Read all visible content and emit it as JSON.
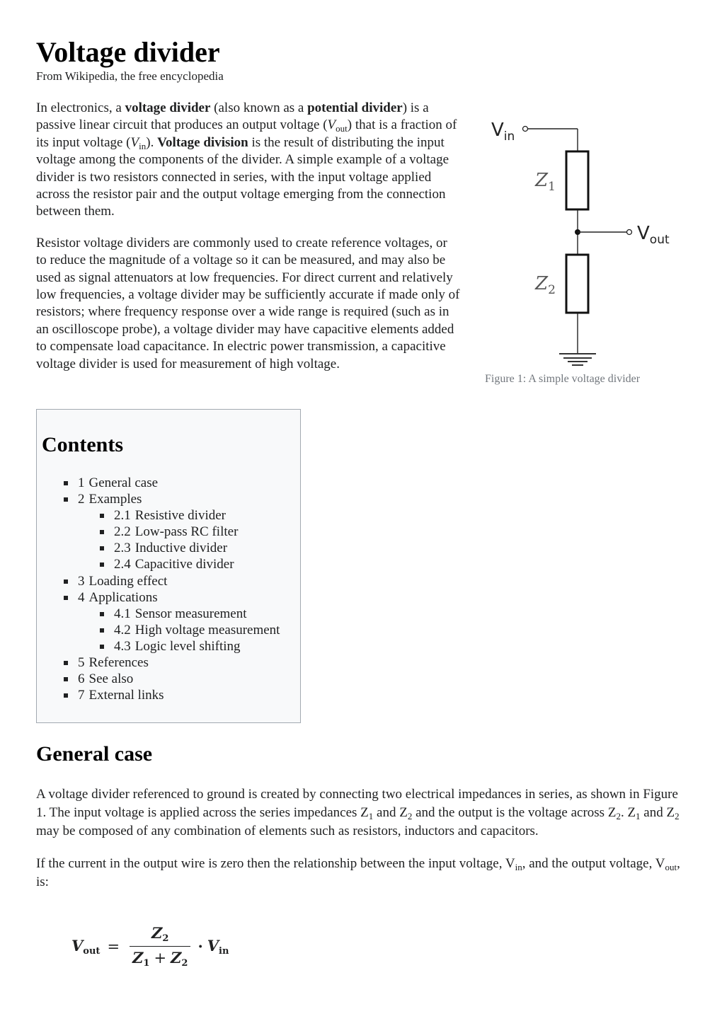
{
  "article": {
    "title": "Voltage divider",
    "subtitle": "From Wikipedia, the free encyclopedia"
  },
  "lead": {
    "p1": {
      "t1": "In electronics, a ",
      "b1": "voltage divider",
      "t2": " (also known as a ",
      "b2": "potential divider",
      "t3": ") is a passive linear circuit that produces an output voltage (",
      "v_out_sym": "V",
      "v_out_sub": "out",
      "t4": ") that is a fraction of its input voltage (",
      "v_in_sym": "V",
      "v_in_sub": "in",
      "t5": "). ",
      "b3": "Voltage division",
      "t6": " is the result of distributing the input voltage among the components of the divider. A simple example of a voltage divider is two resistors connected in series, with the input voltage applied across the resistor pair and the output voltage emerging from the connection between them."
    },
    "p2": "Resistor voltage dividers are commonly used to create reference voltages, or to reduce the magnitude of a voltage so it can be measured, and may also be used as signal attenuators at low frequencies. For direct current and relatively low frequencies, a voltage divider may be sufficiently accurate if made only of resistors; where frequency response over a wide range is required (such as in an oscilloscope probe), a voltage divider may have capacitive elements added to compensate load capacitance. In electric power transmission, a capacitive voltage divider is used for measurement of high voltage."
  },
  "figure": {
    "caption": "Figure 1: A simple voltage divider",
    "labels": {
      "vin": "V",
      "vin_sub": "in",
      "vout": "V",
      "vout_sub": "out",
      "z1": "Z",
      "z1_sub": "1",
      "z2": "Z",
      "z2_sub": "2"
    }
  },
  "toc": {
    "title": "Contents",
    "items": [
      {
        "num": "1",
        "label": "General case",
        "level": 1
      },
      {
        "num": "2",
        "label": "Examples",
        "level": 1
      },
      {
        "num": "2.1",
        "label": "Resistive divider",
        "level": 2
      },
      {
        "num": "2.2",
        "label": "Low-pass RC filter",
        "level": 2
      },
      {
        "num": "2.3",
        "label": "Inductive divider",
        "level": 2
      },
      {
        "num": "2.4",
        "label": "Capacitive divider",
        "level": 2
      },
      {
        "num": "3",
        "label": "Loading effect",
        "level": 1
      },
      {
        "num": "4",
        "label": "Applications",
        "level": 1
      },
      {
        "num": "4.1",
        "label": "Sensor measurement",
        "level": 2
      },
      {
        "num": "4.2",
        "label": "High voltage measurement",
        "level": 2
      },
      {
        "num": "4.3",
        "label": "Logic level shifting",
        "level": 2
      },
      {
        "num": "5",
        "label": "References",
        "level": 1
      },
      {
        "num": "6",
        "label": "See also",
        "level": 1
      },
      {
        "num": "7",
        "label": "External links",
        "level": 1
      }
    ]
  },
  "general_case": {
    "heading": "General case",
    "p1": {
      "t1": "A voltage divider referenced to ground is created by connecting two electrical impedances in series, as shown in Figure 1. The input voltage is applied across the series impedances Z",
      "s1": "1",
      "t2": " and Z",
      "s2": "2",
      "t3": " and the output is the voltage across Z",
      "s3": "2",
      "t4": ". Z",
      "s4": "1",
      "t5": " and Z",
      "s5": "2",
      "t6": " may be composed of any combination of elements such as resistors, inductors and capacitors."
    },
    "p2": {
      "t1": "If the current in the output wire is zero then the relationship between the input voltage, V",
      "s1": "in",
      "t2": ", and the output voltage, V",
      "s2": "out",
      "t3": ", is:"
    },
    "formula": {
      "lhs": "V",
      "lhs_sub": "out",
      "eq": "=",
      "num": "Z",
      "num_sub": "2",
      "den1": "Z",
      "den1_sub": "1",
      "plus": "+",
      "den2": "Z",
      "den2_sub": "2",
      "dot": "·",
      "rhs": "V",
      "rhs_sub": "in"
    }
  }
}
